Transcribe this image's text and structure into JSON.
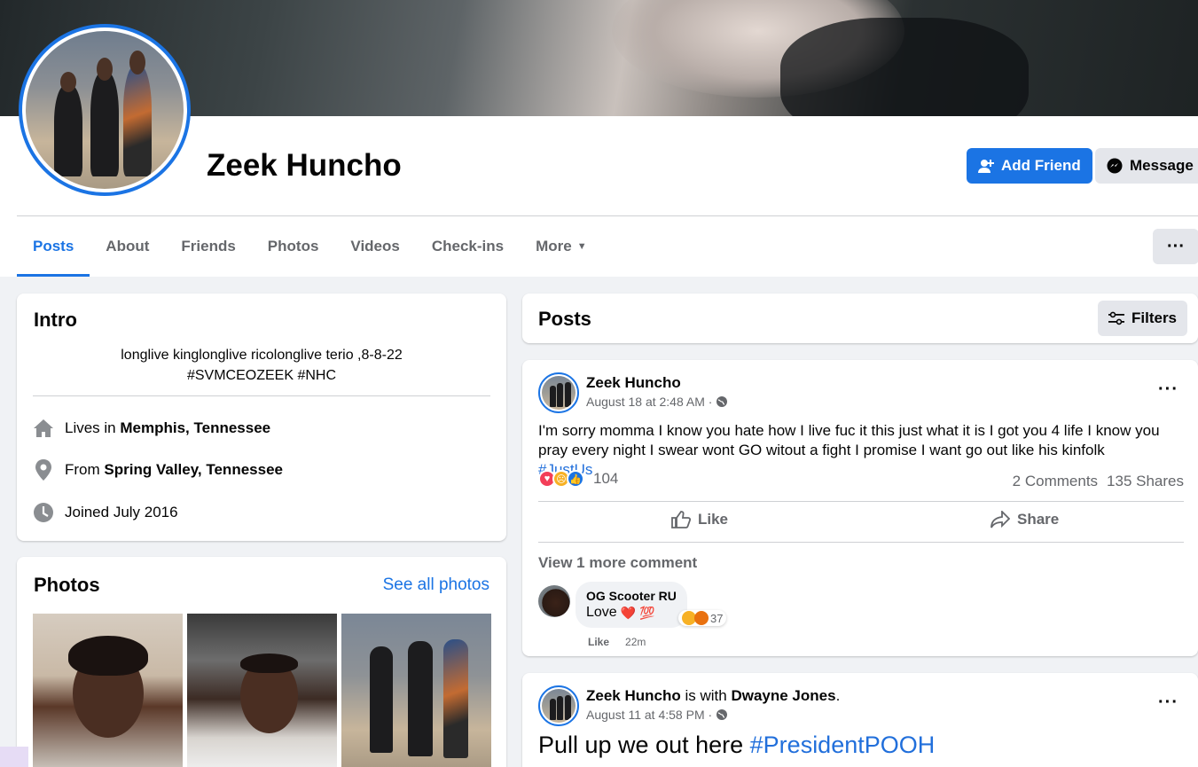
{
  "profile": {
    "name": "Zeek Huncho",
    "add_friend_label": "Add Friend",
    "message_label": "Message"
  },
  "tabs": [
    {
      "label": "Posts",
      "active": true
    },
    {
      "label": "About"
    },
    {
      "label": "Friends"
    },
    {
      "label": "Photos"
    },
    {
      "label": "Videos"
    },
    {
      "label": "Check-ins"
    },
    {
      "label": "More"
    }
  ],
  "intro": {
    "title": "Intro",
    "bio_line1": "longlive kinglonglive ricolonglive terio ,8-8-22",
    "bio_line2": "#SVMCEOZEEK #NHC",
    "lives_prefix": "Lives in",
    "lives_value": "Memphis, Tennessee",
    "from_prefix": "From",
    "from_value": "Spring Valley, Tennessee",
    "joined": "Joined July 2016"
  },
  "photos": {
    "title": "Photos",
    "see_all": "See all photos"
  },
  "posts_header": {
    "title": "Posts",
    "filters_label": "Filters"
  },
  "post1": {
    "author": "Zeek Huncho",
    "date": "August 18 at 2:48 AM ·",
    "text": "I'm sorry momma I know you hate how I live fuc it this just what it is I got you 4 life I know you pray every night I swear wont GO witout a fight I promise I want go out like his kinfolk ",
    "hashtag": "#JustUs",
    "reaction_count": "104",
    "comments": "2 Comments",
    "shares": "135 Shares",
    "like_label": "Like",
    "share_label": "Share",
    "view_more": "View 1 more comment",
    "comment": {
      "author": "OG Scooter RU",
      "text": "Love",
      "emoji": "❤️ 💯",
      "reaction_count": "37",
      "like_label": "Like",
      "time": "22m"
    }
  },
  "post2": {
    "author": "Zeek Huncho",
    "with_text": "is with",
    "tagged": "Dwayne Jones",
    "period": ".",
    "date": "August 11 at 4:58 PM ·",
    "text": "Pull up we out here ",
    "hashtag": "#PresidentPOOH"
  },
  "colors": {
    "accent": "#1b74e4",
    "background": "#f0f2f5",
    "secondary_text": "#65676b"
  },
  "icons": [
    "add-friend-icon",
    "messenger-icon",
    "home-icon",
    "location-pin-icon",
    "clock-icon",
    "filters-icon",
    "globe-icon",
    "like-icon",
    "share-icon",
    "more-dots-icon"
  ]
}
